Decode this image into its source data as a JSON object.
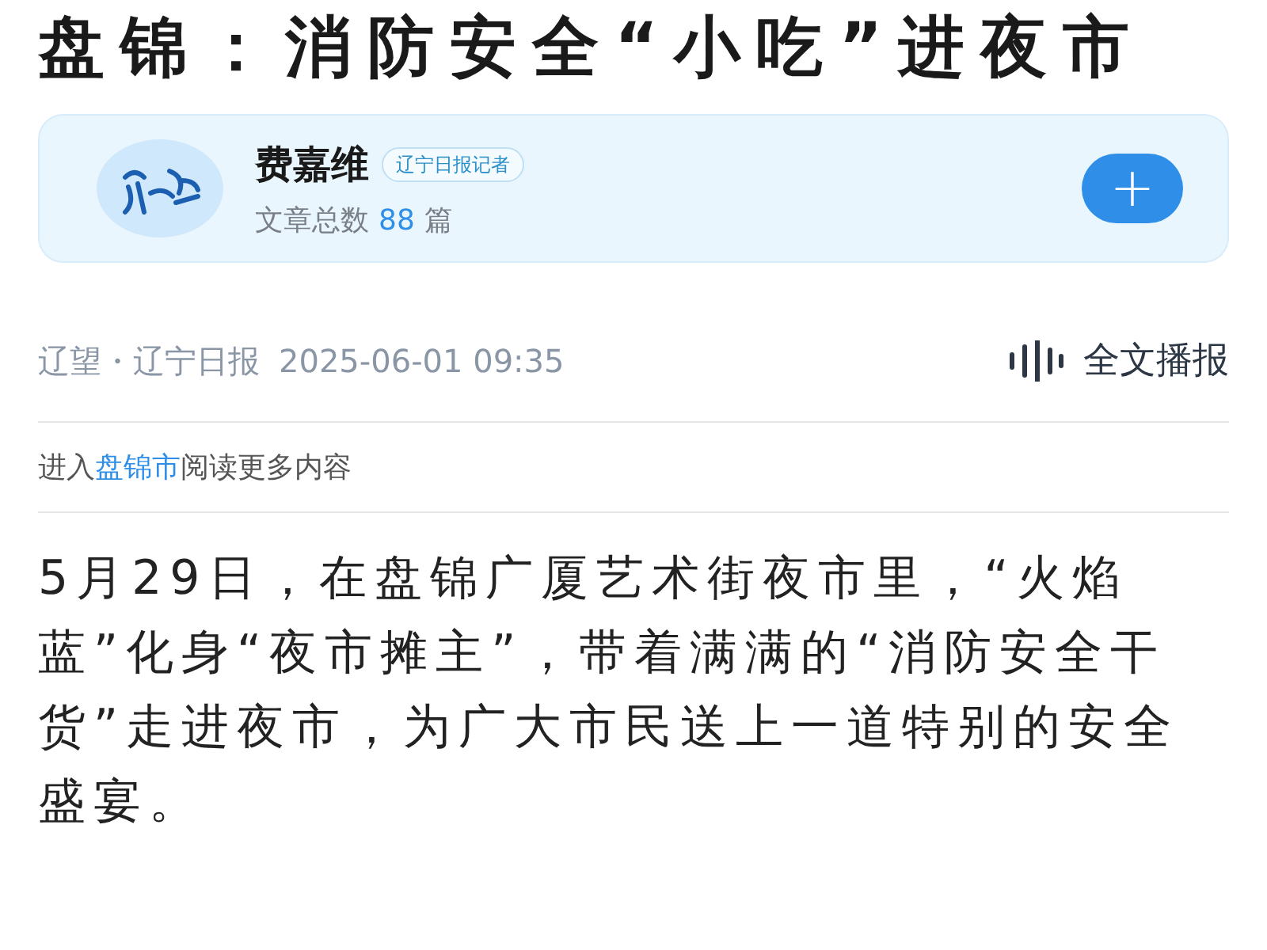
{
  "article": {
    "title": "盘锦：消防安全“小吃”进夜市"
  },
  "author_card": {
    "name": "费嘉维",
    "badge": "辽宁日报记者",
    "count_label": "文章总数",
    "count": "88",
    "count_unit": "篇",
    "follow_button": "+"
  },
  "meta": {
    "source": "辽望・辽宁日报",
    "time": "2025-06-01 09:35",
    "listen_button": "全文播报"
  },
  "channel_link": {
    "prefix": "进入",
    "link": "盘锦市",
    "suffix": "阅读更多内容"
  },
  "body": "5月29日，在盘锦广厦艺术街夜市里，“火焰蓝”化身“夜市摊主”，带着满满的“消防安全干货”走进夜市，为广大市民送上一道特别的安全盛宴。"
}
